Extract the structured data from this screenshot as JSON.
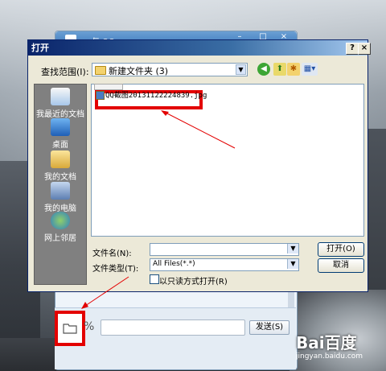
{
  "qq_window": {
    "title": "与 QQ …",
    "send_label": "发送(S)"
  },
  "dialog": {
    "title": "打开",
    "help_label": "?",
    "close_label": "×",
    "look_in_label": "查找范围(I):",
    "look_in_value": "新建文件夹 (3)"
  },
  "places": [
    {
      "label": "我最近的文档",
      "icon": "recent-docs-icon"
    },
    {
      "label": "桌面",
      "icon": "desktop-icon"
    },
    {
      "label": "我的文档",
      "icon": "my-documents-icon"
    },
    {
      "label": "我的电脑",
      "icon": "my-computer-icon"
    },
    {
      "label": "网上邻居",
      "icon": "network-icon"
    }
  ],
  "files": [
    {
      "name": "QQ截图20131122224839.jpg",
      "icon": "image-file-icon"
    }
  ],
  "file_name_label": "文件名(N):",
  "file_name_value": "",
  "file_type_label": "文件类型(T):",
  "file_type_value": "All Files(*.*)",
  "read_only_label": "以只读方式打开(R)",
  "open_button": "打开(O)",
  "cancel_button": "取消",
  "watermark": {
    "logo": "Bai百度",
    "url": "jingyan.baidu.com"
  },
  "colors": {
    "highlight": "#e30000",
    "title_bar": "#0a246a",
    "dialog_bg": "#ece9d8"
  }
}
